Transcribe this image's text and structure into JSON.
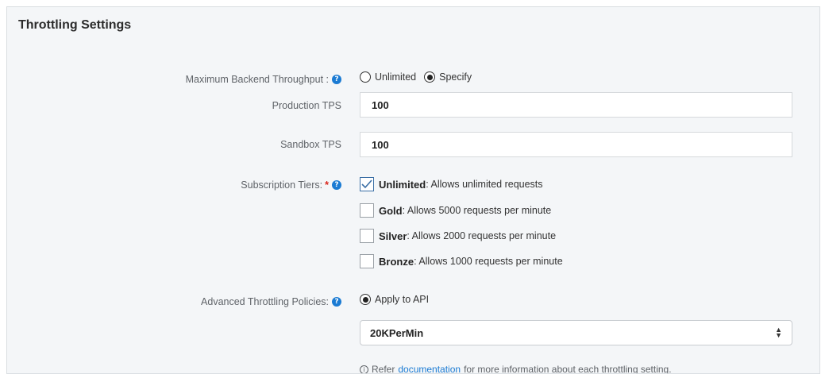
{
  "panel": {
    "title": "Throttling Settings"
  },
  "backend_throughput": {
    "label": "Maximum Backend Throughput :",
    "help_icon": "question-circle-icon",
    "options": [
      {
        "label": "Unlimited",
        "checked": false
      },
      {
        "label": "Specify",
        "checked": true
      }
    ]
  },
  "production_tps": {
    "label": "Production TPS",
    "value": "100"
  },
  "sandbox_tps": {
    "label": "Sandbox TPS",
    "value": "100"
  },
  "subscription_tiers": {
    "label": "Subscription Tiers:",
    "required_mark": "*",
    "help_icon": "question-circle-icon",
    "tiers": [
      {
        "name": "Unlimited",
        "description": " : Allows unlimited requests",
        "checked": true
      },
      {
        "name": "Gold",
        "description": " : Allows 5000 requests per minute",
        "checked": false
      },
      {
        "name": "Silver",
        "description": " : Allows 2000 requests per minute",
        "checked": false
      },
      {
        "name": "Bronze",
        "description": " : Allows 1000 requests per minute",
        "checked": false
      }
    ]
  },
  "advanced_policies": {
    "label": "Advanced Throttling Policies:",
    "help_icon": "question-circle-icon",
    "option": {
      "label": "Apply to API",
      "checked": true
    },
    "selected_policy": "20KPerMin"
  },
  "hint": {
    "icon": "info-circle-icon",
    "prefix": "Refer",
    "link_text": "documentation",
    "suffix": "for more information about each throttling setting."
  },
  "colors": {
    "accent": "#1b7bd3",
    "required": "#d9261c",
    "panel_bg": "#f4f6f8"
  }
}
